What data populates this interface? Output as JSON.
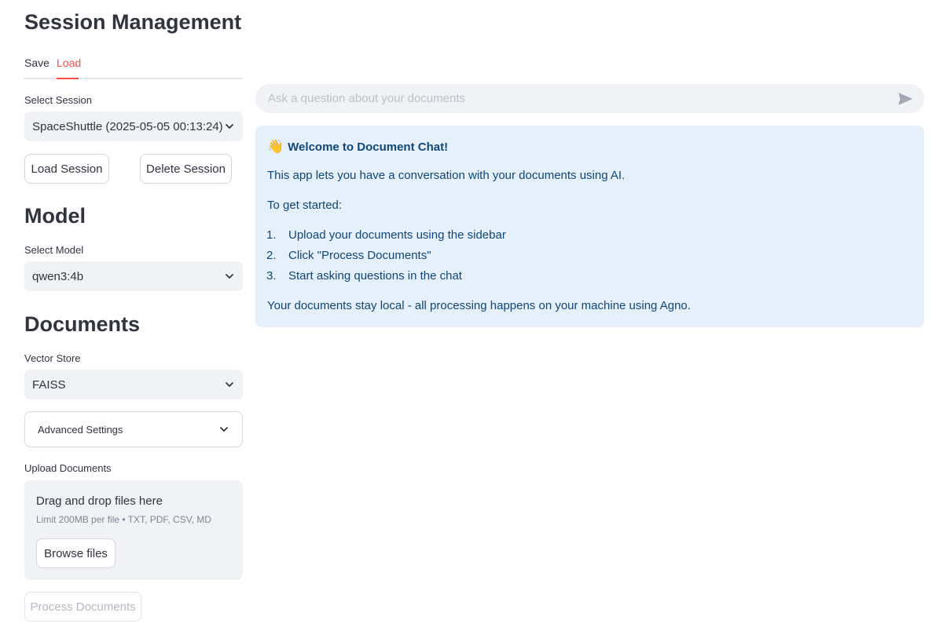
{
  "sidebar": {
    "title": "Session Management",
    "tabs": [
      {
        "label": "Save"
      },
      {
        "label": "Load"
      }
    ],
    "select_session_label": "Select Session",
    "select_session_value": "SpaceShuttle (2025-05-05 00:13:24)",
    "load_session_button": "Load Session",
    "delete_session_button": "Delete Session",
    "model_heading": "Model",
    "select_model_label": "Select Model",
    "select_model_value": "qwen3:4b",
    "documents_heading": "Documents",
    "vector_store_label": "Vector Store",
    "vector_store_value": "FAISS",
    "advanced_settings_label": "Advanced Settings",
    "upload_label": "Upload Documents",
    "dropzone_title": "Drag and drop files here",
    "dropzone_limit": "Limit 200MB per file • TXT, PDF, CSV, MD",
    "browse_button": "Browse files",
    "process_button": "Process Documents"
  },
  "main": {
    "chat_placeholder": "Ask a question about your documents",
    "info": {
      "emoji": "👋",
      "title": "Welcome to Document Chat!",
      "intro": "This app lets you have a conversation with your documents using AI.",
      "get_started": "To get started:",
      "steps": [
        {
          "num": "1.",
          "text": "Upload your documents using the sidebar"
        },
        {
          "num": "2.",
          "text": "Click \"Process Documents\""
        },
        {
          "num": "3.",
          "text": "Start asking questions in the chat"
        }
      ],
      "footer": "Your documents stay local - all processing happens on your machine using Agno."
    }
  },
  "colors": {
    "accent": "#ff4b4b",
    "info_bg": "#e6f0fb",
    "info_text": "#0f4677",
    "input_bg": "#f0f2f6"
  },
  "icons": {
    "select_chevron": "chevron-down-icon",
    "send": "send-icon",
    "wave": "waving-hand-icon"
  }
}
